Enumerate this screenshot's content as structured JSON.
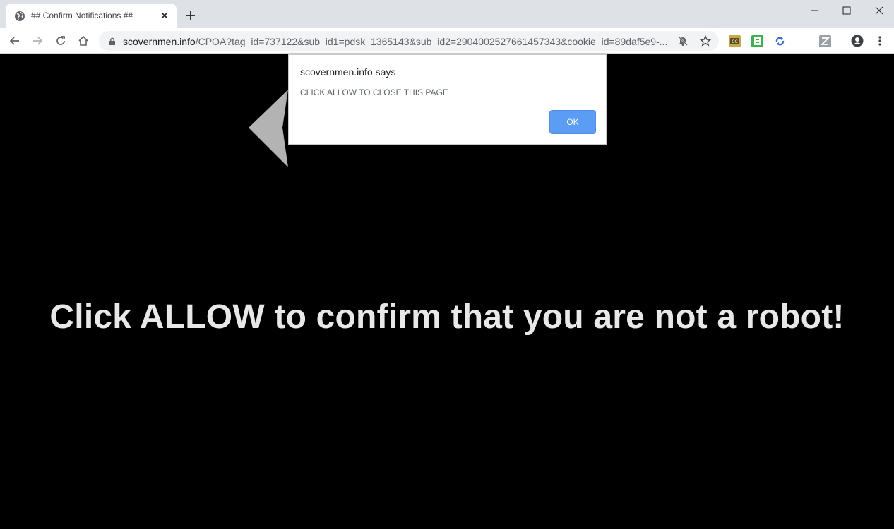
{
  "browser": {
    "tab": {
      "title": "## Confirm Notifications ##",
      "favicon": "globe-icon"
    },
    "new_tab_icon": "plus-icon",
    "window_controls": [
      "minimize-icon",
      "maximize-icon",
      "close-icon"
    ],
    "toolbar": {
      "back_icon": "back-arrow-icon",
      "forward_icon": "forward-arrow-icon",
      "reload_icon": "reload-icon",
      "home_icon": "home-icon",
      "address": {
        "host": "scovernmen.info",
        "path": "/CPOA?tag_id=737122&sub_id1=pdsk_1365143&sub_id2=2904002527661457343&cookie_id=89daf5e9-..."
      },
      "notifications_blocked_icon": "bell-off-icon",
      "bookmark_icon": "star-icon",
      "extensions": [
        "cc-extension-icon",
        "green-extension-icon",
        "sync-extension-icon",
        "z-extension-icon"
      ],
      "profile_icon": "account-circle-icon",
      "menu_icon": "more-vertical-icon"
    }
  },
  "dialog": {
    "title": "scovernmen.info says",
    "message": "CLICK ALLOW TO CLOSE THIS PAGE",
    "ok_label": "OK"
  },
  "page": {
    "headline": "Click ALLOW to confirm that you are not a robot!",
    "arrow_icon": "left-arrow-icon"
  },
  "colors": {
    "page_background": "#000000",
    "headline": "#e8e8e8",
    "arrow": "#b3b3b3",
    "ok_button": "#5b9cf4",
    "tabstrip": "#dee1e6"
  }
}
